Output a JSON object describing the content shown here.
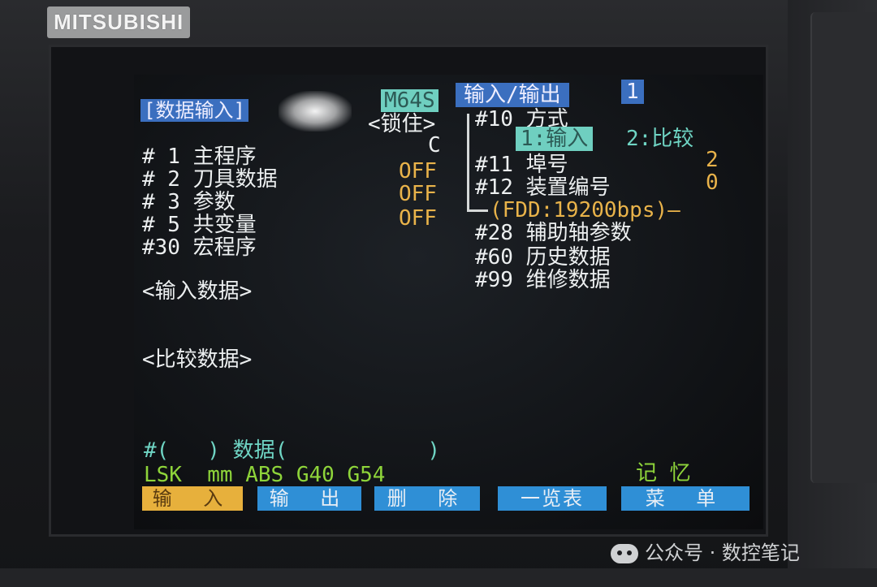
{
  "brand": "MITSUBISHI",
  "header": {
    "screen_title": "[数据输入]",
    "model": "M64S",
    "lock": "<锁住>",
    "io_title": "输入/输出",
    "io_number": "1"
  },
  "left_items": [
    {
      "label": "# 1 主程序",
      "status": "C"
    },
    {
      "label": "# 2 刀具数据",
      "status": "OFF"
    },
    {
      "label": "# 3 参数",
      "status": "OFF"
    },
    {
      "label": "# 5 共变量",
      "status": "OFF"
    },
    {
      "label": "#30 宏程序",
      "status": ""
    }
  ],
  "right_panel": {
    "mode_label": "#10 方式",
    "mode_selected": "1:输入",
    "mode_other": "2:比较",
    "port_label": "#11 埠号",
    "port_value": "2",
    "device_label": "#12 装置编号",
    "device_value": "0",
    "device_info": "(FDD:19200bps)—",
    "extra_items": [
      "#28 辅助轴参数",
      "#60 历史数据",
      "#99 维修数据"
    ]
  },
  "input_data_label": "<输入数据>",
  "compare_data_label": "<比较数据>",
  "command_line": "#(   ) 数据(           )",
  "status_bar": {
    "left": "LSK  mm ABS G40 G54",
    "right": "记 忆"
  },
  "softkeys": [
    {
      "label": "输 入",
      "color": "#e7b03c",
      "text_color": "#5a3b10"
    },
    {
      "label": "输 出",
      "color": "#2f8fd6",
      "text_color": "#e8eef5"
    },
    {
      "label": "删 除",
      "color": "#2f8fd6",
      "text_color": "#e8eef5"
    },
    {
      "label": "一览表",
      "color": "#2f8fd6",
      "text_color": "#e8eef5"
    },
    {
      "label": "菜 单",
      "color": "#2f8fd6",
      "text_color": "#e8eef5"
    }
  ],
  "watermark": "公众号 · 数控笔记",
  "colors": {
    "accent_blue": "#3b6fbf",
    "highlight_cyan": "#6fcfc0",
    "status_yellow": "#e9b34a",
    "status_green": "#8ed43a"
  }
}
